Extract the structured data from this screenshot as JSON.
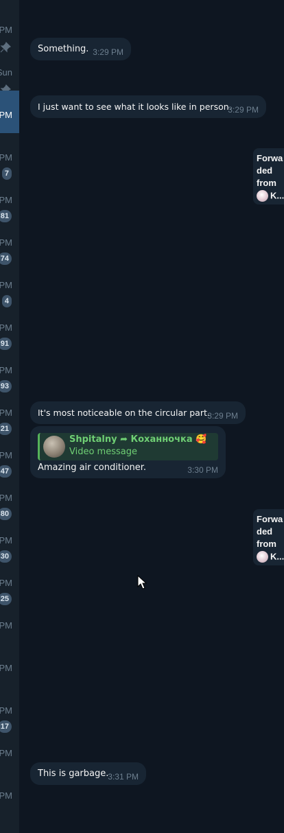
{
  "sidebar": {
    "rows": [
      {
        "time": "PM",
        "badge": null,
        "pinned": true,
        "active": false
      },
      {
        "time": "Sun",
        "badge": null,
        "pinned": true,
        "active": false
      },
      {
        "time": "PM",
        "badge": null,
        "pinned": false,
        "active": true
      },
      {
        "time": "PM",
        "badge": "7",
        "pinned": false,
        "active": false
      },
      {
        "time": "PM",
        "badge": "81",
        "pinned": false,
        "active": false
      },
      {
        "time": "PM",
        "badge": "74",
        "pinned": false,
        "active": false
      },
      {
        "time": "PM",
        "badge": "4",
        "pinned": false,
        "active": false
      },
      {
        "time": "PM",
        "badge": "91",
        "pinned": false,
        "active": false
      },
      {
        "time": "PM",
        "badge": "93",
        "pinned": false,
        "active": false
      },
      {
        "time": "PM",
        "badge": "21",
        "pinned": false,
        "active": false
      },
      {
        "time": "PM",
        "badge": "47",
        "pinned": false,
        "active": false
      },
      {
        "time": "PM",
        "badge": "80",
        "pinned": false,
        "active": false
      },
      {
        "time": "PM",
        "badge": "30",
        "pinned": false,
        "active": false
      },
      {
        "time": "PM",
        "badge": "25",
        "pinned": false,
        "active": false
      },
      {
        "time": "PM",
        "badge": null,
        "pinned": false,
        "active": false
      },
      {
        "time": "PM",
        "badge": null,
        "pinned": false,
        "active": false
      },
      {
        "time": "PM",
        "badge": "17",
        "pinned": false,
        "active": false
      },
      {
        "time": "PM",
        "badge": null,
        "pinned": false,
        "active": false
      },
      {
        "time": "PM",
        "badge": null,
        "pinned": false,
        "active": false
      }
    ]
  },
  "messages": {
    "m1": {
      "text": "Something.",
      "time": "3:29 PM"
    },
    "m2": {
      "text": "I just want to see what it looks like in person.",
      "time": "3:29 PM"
    },
    "m3": {
      "text": "It's most noticeable on the circular part.",
      "time": "3:29 PM"
    },
    "m4": {
      "reply_title": "Shpitalny ➦ Коханночка 🥰",
      "reply_subtitle": "Video message",
      "text": "Amazing air conditioner.",
      "time": "3:30 PM"
    },
    "m5": {
      "text": "This is garbage.",
      "time": "3:31 PM"
    }
  },
  "forwarded": {
    "line1": "Forwa",
    "line2": "ded",
    "line3": "from",
    "name": "K..."
  },
  "colors": {
    "background": "#0e1621",
    "bubble": "#182533",
    "sidebar": "#17212b",
    "active_row": "#2b5278",
    "reply_accent": "#6fcf74"
  },
  "icons": {
    "pin": "pin-icon",
    "cursor": "mouse-cursor-icon"
  }
}
